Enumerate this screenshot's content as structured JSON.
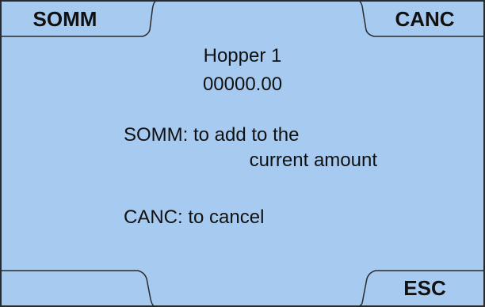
{
  "softkeys": {
    "top_left": "SOMM",
    "top_right": "CANC",
    "bottom_left": "",
    "bottom_right": "ESC"
  },
  "display": {
    "title": "Hopper 1",
    "amount": "00000.00",
    "somm_help_line1": "SOMM: to add to the",
    "somm_help_line2": "current amount",
    "canc_help": "CANC: to cancel"
  },
  "colors": {
    "background": "#a6caf0",
    "frame": "#2a2a2a"
  }
}
